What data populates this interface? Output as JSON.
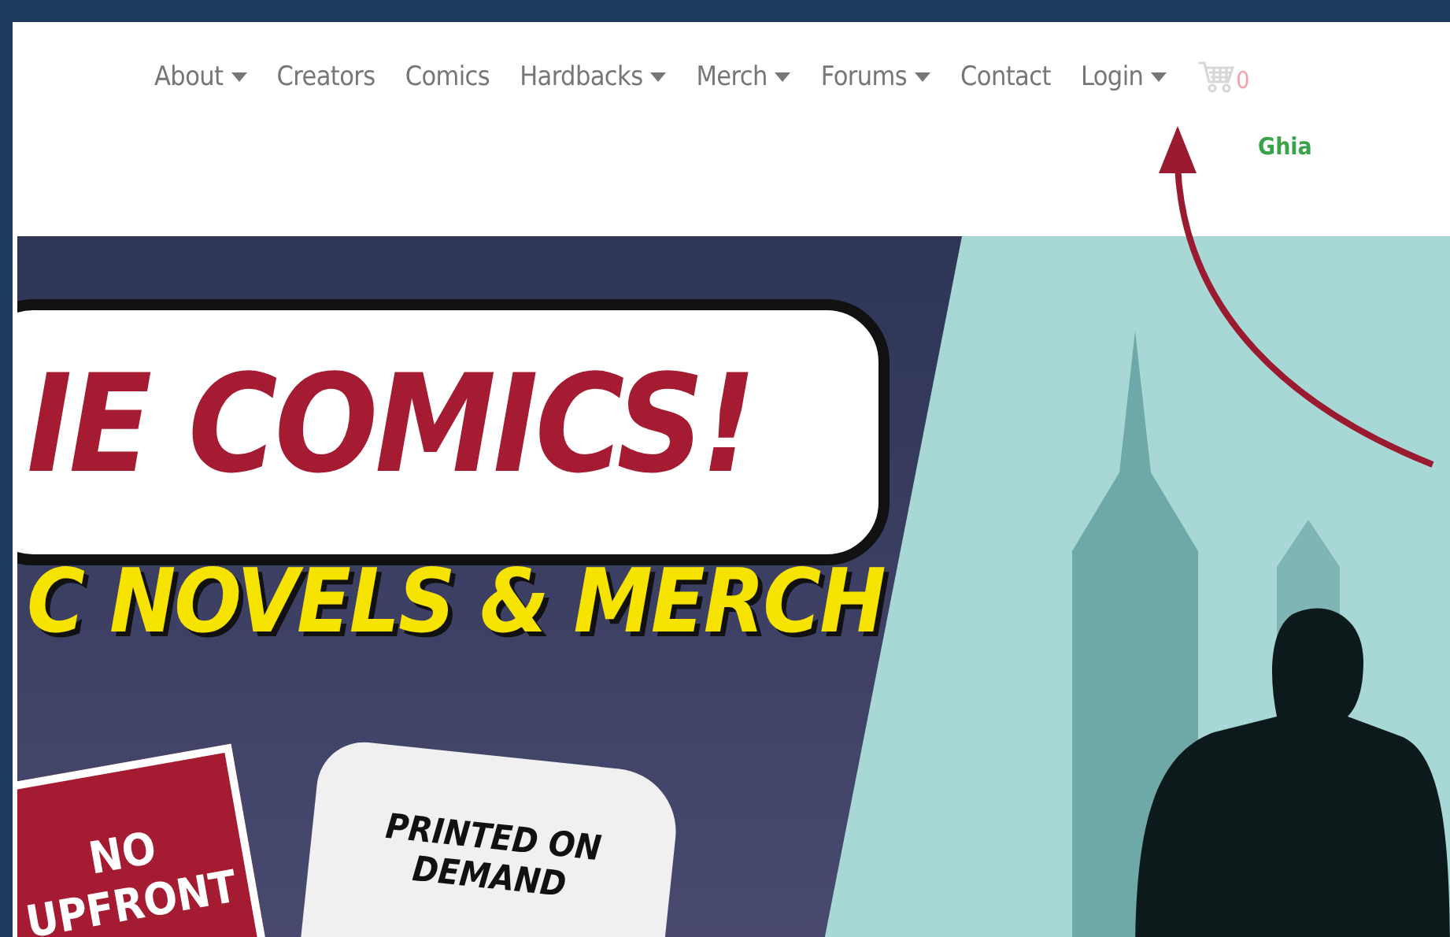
{
  "nav": {
    "items": [
      {
        "label": "About",
        "dropdown": true
      },
      {
        "label": "Creators",
        "dropdown": false
      },
      {
        "label": "Comics",
        "dropdown": false
      },
      {
        "label": "Hardbacks",
        "dropdown": true
      },
      {
        "label": "Merch",
        "dropdown": true
      },
      {
        "label": "Forums",
        "dropdown": true
      },
      {
        "label": "Contact",
        "dropdown": false
      },
      {
        "label": "Login",
        "dropdown": true
      }
    ],
    "cart_count": "0",
    "user": "Ghia"
  },
  "banner": {
    "headline": "IE COMICS!",
    "subheadline": "C NOVELS & MERCH",
    "sign_lines": [
      "NO",
      "UPFRONT"
    ],
    "shirt_lines": [
      "PRINTED ON",
      "DEMAND"
    ]
  }
}
